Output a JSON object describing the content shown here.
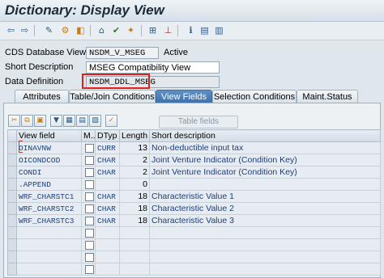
{
  "window": {
    "title": "Dictionary: Display View"
  },
  "toolbar": {
    "icons": [
      "back-arrow-icon",
      "forward-arrow-icon",
      "edit-glasses-icon",
      "display-change-icon",
      "other-object-icon",
      "where-used-icon",
      "check-icon",
      "activate-icon",
      "hierarchy-icon",
      "hierarchy2-icon",
      "info-icon",
      "table-grid-icon"
    ]
  },
  "header": {
    "cds_label": "CDS Database View",
    "cds_value": "NSDM_V_MSEG",
    "status": "Active",
    "short_desc_label": "Short Description",
    "short_desc_value": "MSEG Compatibility View",
    "data_def_label": "Data Definition",
    "data_def_value": "NSDM_DDL_MSEG"
  },
  "tabs": [
    {
      "label": "Attributes",
      "active": false
    },
    {
      "label": "Table/Join Conditions",
      "active": false
    },
    {
      "label": "View Fields",
      "active": true
    },
    {
      "label": "Selection Conditions",
      "active": false
    },
    {
      "label": "Maint.Status",
      "active": false
    }
  ],
  "panel_toolbar": {
    "table_fields_label": "Table fields"
  },
  "grid": {
    "headers": [
      "View field",
      "M...",
      "DTyp",
      "Length",
      "Short description"
    ],
    "rows": [
      {
        "field": "OINAVNW",
        "dtyp": "CURR",
        "length": "13",
        "desc": "Non-deductible input tax"
      },
      {
        "field": "OICONDCOD",
        "dtyp": "CHAR",
        "length": "2",
        "desc": "Joint Venture Indicator (Condition Key)"
      },
      {
        "field": "CONDI",
        "dtyp": "CHAR",
        "length": "2",
        "desc": "Joint Venture Indicator (Condition Key)"
      },
      {
        "field": ".APPEND",
        "dtyp": "",
        "length": "0",
        "desc": ""
      },
      {
        "field": "WRF_CHARSTC1",
        "dtyp": "CHAR",
        "length": "18",
        "desc": "Characteristic Value 1"
      },
      {
        "field": "WRF_CHARSTC2",
        "dtyp": "CHAR",
        "length": "18",
        "desc": "Characteristic Value 2"
      },
      {
        "field": "WRF_CHARSTC3",
        "dtyp": "CHAR",
        "length": "18",
        "desc": "Characteristic Value 3"
      },
      {
        "field": "",
        "dtyp": "",
        "length": "",
        "desc": ""
      },
      {
        "field": "",
        "dtyp": "",
        "length": "",
        "desc": ""
      },
      {
        "field": "",
        "dtyp": "",
        "length": "",
        "desc": ""
      },
      {
        "field": "",
        "dtyp": "",
        "length": "",
        "desc": ""
      }
    ]
  },
  "colors": {
    "active_tab": "#4a7db5",
    "highlight_border": "#e0201a"
  }
}
